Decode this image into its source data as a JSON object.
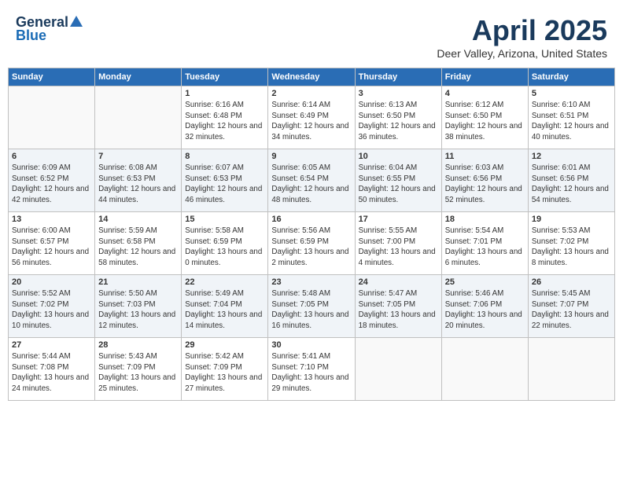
{
  "logo": {
    "general": "General",
    "blue": "Blue"
  },
  "title": {
    "month": "April 2025",
    "location": "Deer Valley, Arizona, United States"
  },
  "headers": [
    "Sunday",
    "Monday",
    "Tuesday",
    "Wednesday",
    "Thursday",
    "Friday",
    "Saturday"
  ],
  "weeks": [
    [
      {
        "day": "",
        "info": ""
      },
      {
        "day": "",
        "info": ""
      },
      {
        "day": "1",
        "info": "Sunrise: 6:16 AM\nSunset: 6:48 PM\nDaylight: 12 hours\nand 32 minutes."
      },
      {
        "day": "2",
        "info": "Sunrise: 6:14 AM\nSunset: 6:49 PM\nDaylight: 12 hours\nand 34 minutes."
      },
      {
        "day": "3",
        "info": "Sunrise: 6:13 AM\nSunset: 6:50 PM\nDaylight: 12 hours\nand 36 minutes."
      },
      {
        "day": "4",
        "info": "Sunrise: 6:12 AM\nSunset: 6:50 PM\nDaylight: 12 hours\nand 38 minutes."
      },
      {
        "day": "5",
        "info": "Sunrise: 6:10 AM\nSunset: 6:51 PM\nDaylight: 12 hours\nand 40 minutes."
      }
    ],
    [
      {
        "day": "6",
        "info": "Sunrise: 6:09 AM\nSunset: 6:52 PM\nDaylight: 12 hours\nand 42 minutes."
      },
      {
        "day": "7",
        "info": "Sunrise: 6:08 AM\nSunset: 6:53 PM\nDaylight: 12 hours\nand 44 minutes."
      },
      {
        "day": "8",
        "info": "Sunrise: 6:07 AM\nSunset: 6:53 PM\nDaylight: 12 hours\nand 46 minutes."
      },
      {
        "day": "9",
        "info": "Sunrise: 6:05 AM\nSunset: 6:54 PM\nDaylight: 12 hours\nand 48 minutes."
      },
      {
        "day": "10",
        "info": "Sunrise: 6:04 AM\nSunset: 6:55 PM\nDaylight: 12 hours\nand 50 minutes."
      },
      {
        "day": "11",
        "info": "Sunrise: 6:03 AM\nSunset: 6:56 PM\nDaylight: 12 hours\nand 52 minutes."
      },
      {
        "day": "12",
        "info": "Sunrise: 6:01 AM\nSunset: 6:56 PM\nDaylight: 12 hours\nand 54 minutes."
      }
    ],
    [
      {
        "day": "13",
        "info": "Sunrise: 6:00 AM\nSunset: 6:57 PM\nDaylight: 12 hours\nand 56 minutes."
      },
      {
        "day": "14",
        "info": "Sunrise: 5:59 AM\nSunset: 6:58 PM\nDaylight: 12 hours\nand 58 minutes."
      },
      {
        "day": "15",
        "info": "Sunrise: 5:58 AM\nSunset: 6:59 PM\nDaylight: 13 hours\nand 0 minutes."
      },
      {
        "day": "16",
        "info": "Sunrise: 5:56 AM\nSunset: 6:59 PM\nDaylight: 13 hours\nand 2 minutes."
      },
      {
        "day": "17",
        "info": "Sunrise: 5:55 AM\nSunset: 7:00 PM\nDaylight: 13 hours\nand 4 minutes."
      },
      {
        "day": "18",
        "info": "Sunrise: 5:54 AM\nSunset: 7:01 PM\nDaylight: 13 hours\nand 6 minutes."
      },
      {
        "day": "19",
        "info": "Sunrise: 5:53 AM\nSunset: 7:02 PM\nDaylight: 13 hours\nand 8 minutes."
      }
    ],
    [
      {
        "day": "20",
        "info": "Sunrise: 5:52 AM\nSunset: 7:02 PM\nDaylight: 13 hours\nand 10 minutes."
      },
      {
        "day": "21",
        "info": "Sunrise: 5:50 AM\nSunset: 7:03 PM\nDaylight: 13 hours\nand 12 minutes."
      },
      {
        "day": "22",
        "info": "Sunrise: 5:49 AM\nSunset: 7:04 PM\nDaylight: 13 hours\nand 14 minutes."
      },
      {
        "day": "23",
        "info": "Sunrise: 5:48 AM\nSunset: 7:05 PM\nDaylight: 13 hours\nand 16 minutes."
      },
      {
        "day": "24",
        "info": "Sunrise: 5:47 AM\nSunset: 7:05 PM\nDaylight: 13 hours\nand 18 minutes."
      },
      {
        "day": "25",
        "info": "Sunrise: 5:46 AM\nSunset: 7:06 PM\nDaylight: 13 hours\nand 20 minutes."
      },
      {
        "day": "26",
        "info": "Sunrise: 5:45 AM\nSunset: 7:07 PM\nDaylight: 13 hours\nand 22 minutes."
      }
    ],
    [
      {
        "day": "27",
        "info": "Sunrise: 5:44 AM\nSunset: 7:08 PM\nDaylight: 13 hours\nand 24 minutes."
      },
      {
        "day": "28",
        "info": "Sunrise: 5:43 AM\nSunset: 7:09 PM\nDaylight: 13 hours\nand 25 minutes."
      },
      {
        "day": "29",
        "info": "Sunrise: 5:42 AM\nSunset: 7:09 PM\nDaylight: 13 hours\nand 27 minutes."
      },
      {
        "day": "30",
        "info": "Sunrise: 5:41 AM\nSunset: 7:10 PM\nDaylight: 13 hours\nand 29 minutes."
      },
      {
        "day": "",
        "info": ""
      },
      {
        "day": "",
        "info": ""
      },
      {
        "day": "",
        "info": ""
      }
    ]
  ]
}
